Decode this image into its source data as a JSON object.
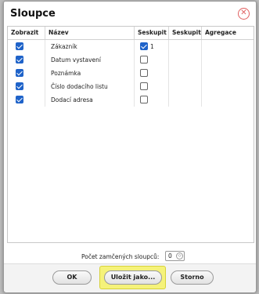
{
  "dialog": {
    "title": "Sloupce",
    "close_icon": "close-circle-icon"
  },
  "columns_table": {
    "headers": [
      "Zobrazit",
      "Název",
      "Seskupit",
      "Seskupit p",
      "Agregace"
    ],
    "rows": [
      {
        "show": true,
        "name": "Zákazník",
        "group": true,
        "group_order": "1"
      },
      {
        "show": true,
        "name": "Datum vystavení",
        "group": false,
        "group_order": ""
      },
      {
        "show": true,
        "name": "Poznámka",
        "group": false,
        "group_order": ""
      },
      {
        "show": true,
        "name": "Číslo dodacího listu",
        "group": false,
        "group_order": ""
      },
      {
        "show": true,
        "name": "Dodací adresa",
        "group": false,
        "group_order": ""
      }
    ]
  },
  "locked_columns": {
    "label": "Počet zamčených sloupců:",
    "value": "0"
  },
  "buttons": {
    "ok": "OK",
    "save_as": "Uložit jako...",
    "cancel": "Storno"
  },
  "colors": {
    "accent_checkbox": "#1f63c9",
    "close_icon": "#e06060",
    "highlight": "#f5f27a"
  }
}
